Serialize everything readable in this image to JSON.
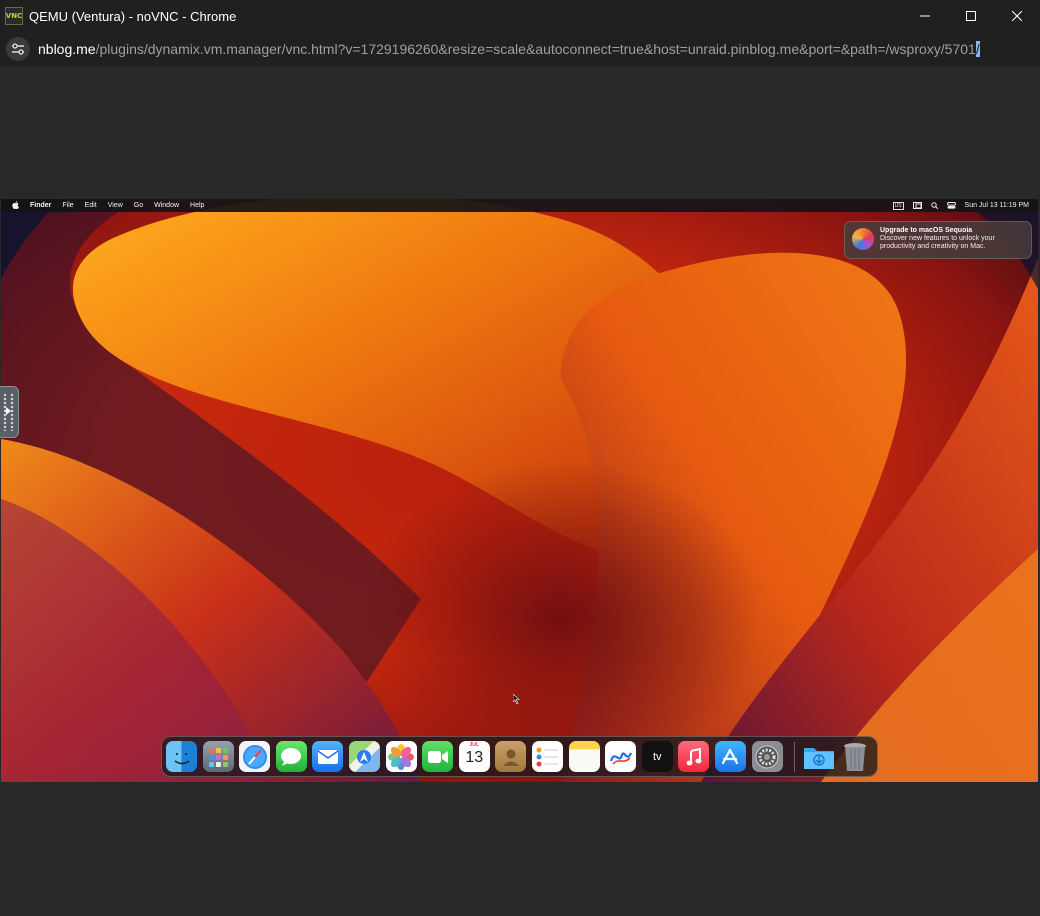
{
  "window": {
    "icon_text": "VNC",
    "title": "QEMU (Ventura) - noVNC - Chrome",
    "controls": [
      "minimize-icon",
      "maximize-icon",
      "close-icon"
    ]
  },
  "address_bar": {
    "host": "nblog.me",
    "path": "/plugins/dynamix.vm.manager/vnc.html?v=1729196260&resize=scale&autoconnect=true&host=unraid.pinblog.me&port=&path=/wsproxy/5701",
    "selected": "/"
  },
  "mac": {
    "menubar": {
      "apple_icon": "apple-icon",
      "items": [
        "Finder",
        "File",
        "Edit",
        "View",
        "Go",
        "Window",
        "Help"
      ],
      "input_source": "US",
      "datetime": "Sun Jul 13  11:19 PM"
    },
    "notification": {
      "title": "Upgrade to macOS Sequoia",
      "body": "Discover new features to unlock your productivity and creativity on Mac."
    },
    "dock": {
      "apps": [
        "Finder",
        "Launchpad",
        "Safari",
        "Messages",
        "Mail",
        "Maps",
        "Photos",
        "FaceTime",
        "Calendar",
        "Contacts",
        "Reminders",
        "Notes",
        "Freeform",
        "TV",
        "Music",
        "App Store",
        "System Settings"
      ],
      "calendar_month": "JUL",
      "calendar_day": "13",
      "tv_label": "tv",
      "trailing": [
        "Downloads",
        "Trash"
      ]
    }
  },
  "colors": {
    "chrome_bg": "#202020",
    "viewport_bg": "#282828",
    "accent_selection": "#8ab4f8"
  }
}
